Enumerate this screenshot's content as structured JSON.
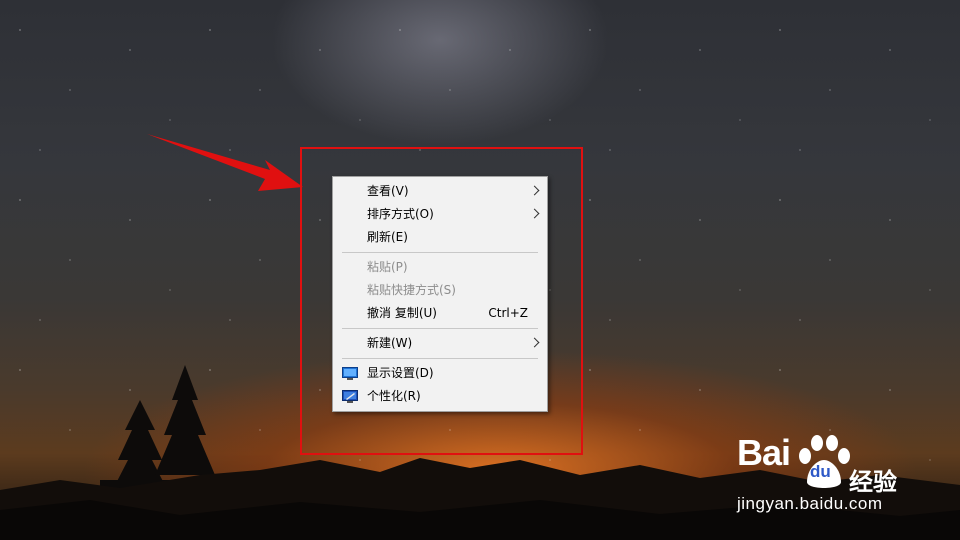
{
  "menu": {
    "items": [
      {
        "label": "查看(V)",
        "has_submenu": true
      },
      {
        "label": "排序方式(O)",
        "has_submenu": true
      },
      {
        "label": "刷新(E)"
      },
      {
        "label": "粘贴(P)",
        "disabled": true
      },
      {
        "label": "粘贴快捷方式(S)",
        "disabled": true
      },
      {
        "label": "撤消 复制(U)",
        "shortcut": "Ctrl+Z"
      },
      {
        "label": "新建(W)",
        "has_submenu": true
      },
      {
        "label": "显示设置(D)",
        "icon": "display-settings-icon"
      },
      {
        "label": "个性化(R)",
        "icon": "personalize-icon"
      }
    ]
  },
  "annotation": {
    "box_color": "#e01010",
    "arrow_color": "#e01010"
  },
  "watermark": {
    "brand": "Bai",
    "brand_du": "du",
    "brand_suffix": "经验",
    "url": "jingyan.baidu.com"
  }
}
